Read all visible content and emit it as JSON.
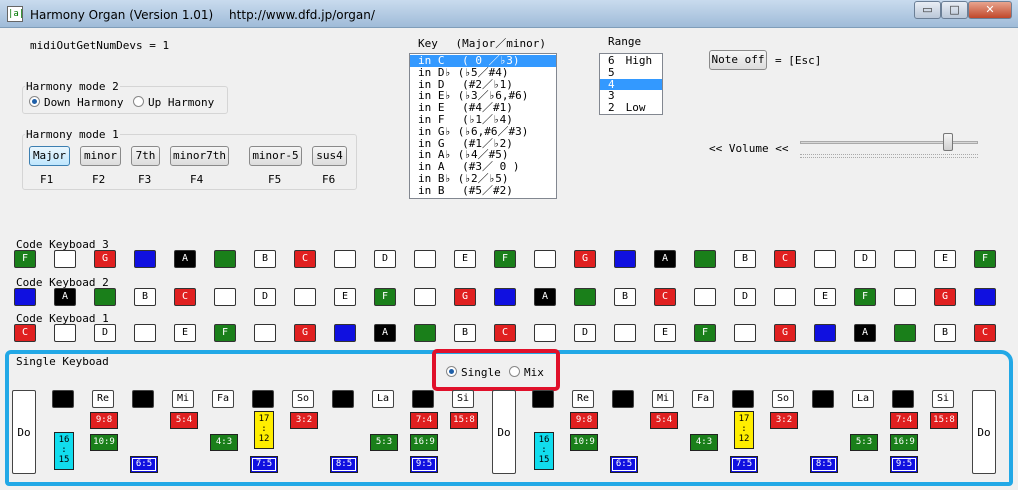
{
  "window": {
    "title": "Harmony Organ (Version 1.01)　 http://www.dfd.jp/organ/",
    "icon_label": "|a|",
    "controls": {
      "minimize": "▭",
      "maximize": "□",
      "close": "✕"
    }
  },
  "midi": {
    "text": "midiOutGetNumDevs = 1"
  },
  "harmony_mode2": {
    "label": "Harmony mode 2",
    "options": [
      "Down Harmony",
      "Up Harmony"
    ],
    "selected": 0
  },
  "harmony_mode1": {
    "label": "Harmony mode 1",
    "buttons": [
      {
        "label": "Major",
        "key": "F1"
      },
      {
        "label": "minor",
        "key": "F2"
      },
      {
        "label": "7th",
        "key": "F3"
      },
      {
        "label": "minor7th",
        "key": "F4"
      },
      {
        "label": "minor-5",
        "key": "F5"
      },
      {
        "label": "sus4",
        "key": "F6"
      }
    ],
    "selected": 0
  },
  "key": {
    "label": "Key　 (Major／minor)",
    "items": [
      "in C　 ( 0 ／♭3)",
      "in D♭ (♭5／#4)",
      "in D　 (#2／♭1)",
      "in E♭ (♭3／♭6,#6)",
      "in E　 (#4／#1)",
      "in F　 (♭1／♭4)",
      "in G♭ (♭6,#6／#3)",
      "in G　 (#1／♭2)",
      "in A♭ (♭4／#5)",
      "in A　 (#3／ 0 )",
      "in B♭ (♭2／♭5)",
      "in B　 (#5／#2)"
    ],
    "selected": 0
  },
  "range": {
    "label": "Range",
    "items": [
      "6　High",
      "5",
      "4",
      "3",
      "2　Low"
    ],
    "selected": 2
  },
  "note_off": {
    "label": "Note off",
    "shortcut": "= [Esc]"
  },
  "volume": {
    "label": "<< Volume <<",
    "value": 0.83
  },
  "keyboard3": {
    "label": "Code Keyboad 3",
    "keys": [
      [
        "F",
        "g"
      ],
      [
        "",
        "w"
      ],
      [
        "G",
        "r"
      ],
      [
        "",
        "b"
      ],
      [
        "A",
        "bk"
      ],
      [
        "",
        "g"
      ],
      [
        "B",
        "w"
      ],
      [
        "C",
        "r"
      ],
      [
        "",
        "w"
      ],
      [
        "D",
        "w"
      ],
      [
        "",
        "w"
      ],
      [
        "E",
        "w"
      ],
      [
        "F",
        "g"
      ],
      [
        "",
        "w"
      ],
      [
        "G",
        "r"
      ],
      [
        "",
        "b"
      ],
      [
        "A",
        "bk"
      ],
      [
        "",
        "g"
      ],
      [
        "B",
        "w"
      ],
      [
        "C",
        "r"
      ],
      [
        "",
        "w"
      ],
      [
        "D",
        "w"
      ],
      [
        "",
        "w"
      ],
      [
        "E",
        "w"
      ],
      [
        "F",
        "g"
      ]
    ]
  },
  "keyboard2": {
    "label": "Code Keyboad 2",
    "keys": [
      [
        "",
        "b"
      ],
      [
        "A",
        "bk"
      ],
      [
        "",
        "g"
      ],
      [
        "B",
        "w"
      ],
      [
        "C",
        "r"
      ],
      [
        "",
        "w"
      ],
      [
        "D",
        "w"
      ],
      [
        "",
        "w"
      ],
      [
        "E",
        "w"
      ],
      [
        "F",
        "g"
      ],
      [
        "",
        "w"
      ],
      [
        "G",
        "r"
      ],
      [
        "",
        "b"
      ],
      [
        "A",
        "bk"
      ],
      [
        "",
        "g"
      ],
      [
        "B",
        "w"
      ],
      [
        "C",
        "r"
      ],
      [
        "",
        "w"
      ],
      [
        "D",
        "w"
      ],
      [
        "",
        "w"
      ],
      [
        "E",
        "w"
      ],
      [
        "F",
        "g"
      ],
      [
        "",
        "w"
      ],
      [
        "G",
        "r"
      ],
      [
        "",
        "b"
      ]
    ]
  },
  "keyboard1": {
    "label": "Code Keyboad 1",
    "keys": [
      [
        "C",
        "r"
      ],
      [
        "",
        "w"
      ],
      [
        "D",
        "w"
      ],
      [
        "",
        "w"
      ],
      [
        "E",
        "w"
      ],
      [
        "F",
        "g"
      ],
      [
        "",
        "w"
      ],
      [
        "G",
        "r"
      ],
      [
        "",
        "b"
      ],
      [
        "A",
        "bk"
      ],
      [
        "",
        "g"
      ],
      [
        "B",
        "w"
      ],
      [
        "C",
        "r"
      ],
      [
        "",
        "w"
      ],
      [
        "D",
        "w"
      ],
      [
        "",
        "w"
      ],
      [
        "E",
        "w"
      ],
      [
        "F",
        "g"
      ],
      [
        "",
        "w"
      ],
      [
        "G",
        "r"
      ],
      [
        "",
        "b"
      ],
      [
        "A",
        "bk"
      ],
      [
        "",
        "g"
      ],
      [
        "B",
        "w"
      ],
      [
        "C",
        "r"
      ]
    ]
  },
  "single": {
    "label": "Single Keyboad",
    "mode_options": [
      "Single",
      "Mix"
    ],
    "mode_selected": 0,
    "do_label": "Do",
    "white_labels": [
      "Re",
      "Mi",
      "Fa",
      "So",
      "La",
      "Si"
    ],
    "ratios_row1": [
      "9:8",
      "5:4",
      "3:2",
      "7:4",
      "15:8"
    ],
    "ratios_row2": [
      "10:9",
      "4:3",
      "5:3",
      "16:9"
    ],
    "ratios_row3": [
      "6:5",
      "7:5",
      "8:5",
      "9:5"
    ],
    "ratio_yellow": "17\n:\n12",
    "ratio_cyan": "16\n:\n15"
  },
  "colors": {
    "green": "#1a7f1a",
    "red": "#e02020",
    "blue": "#1010e0",
    "yellow": "#ffee00",
    "cyan": "#11ddee",
    "highlight": "#3399ff",
    "annotation_red": "#e0102a",
    "annotation_blue": "#22a8e6"
  }
}
